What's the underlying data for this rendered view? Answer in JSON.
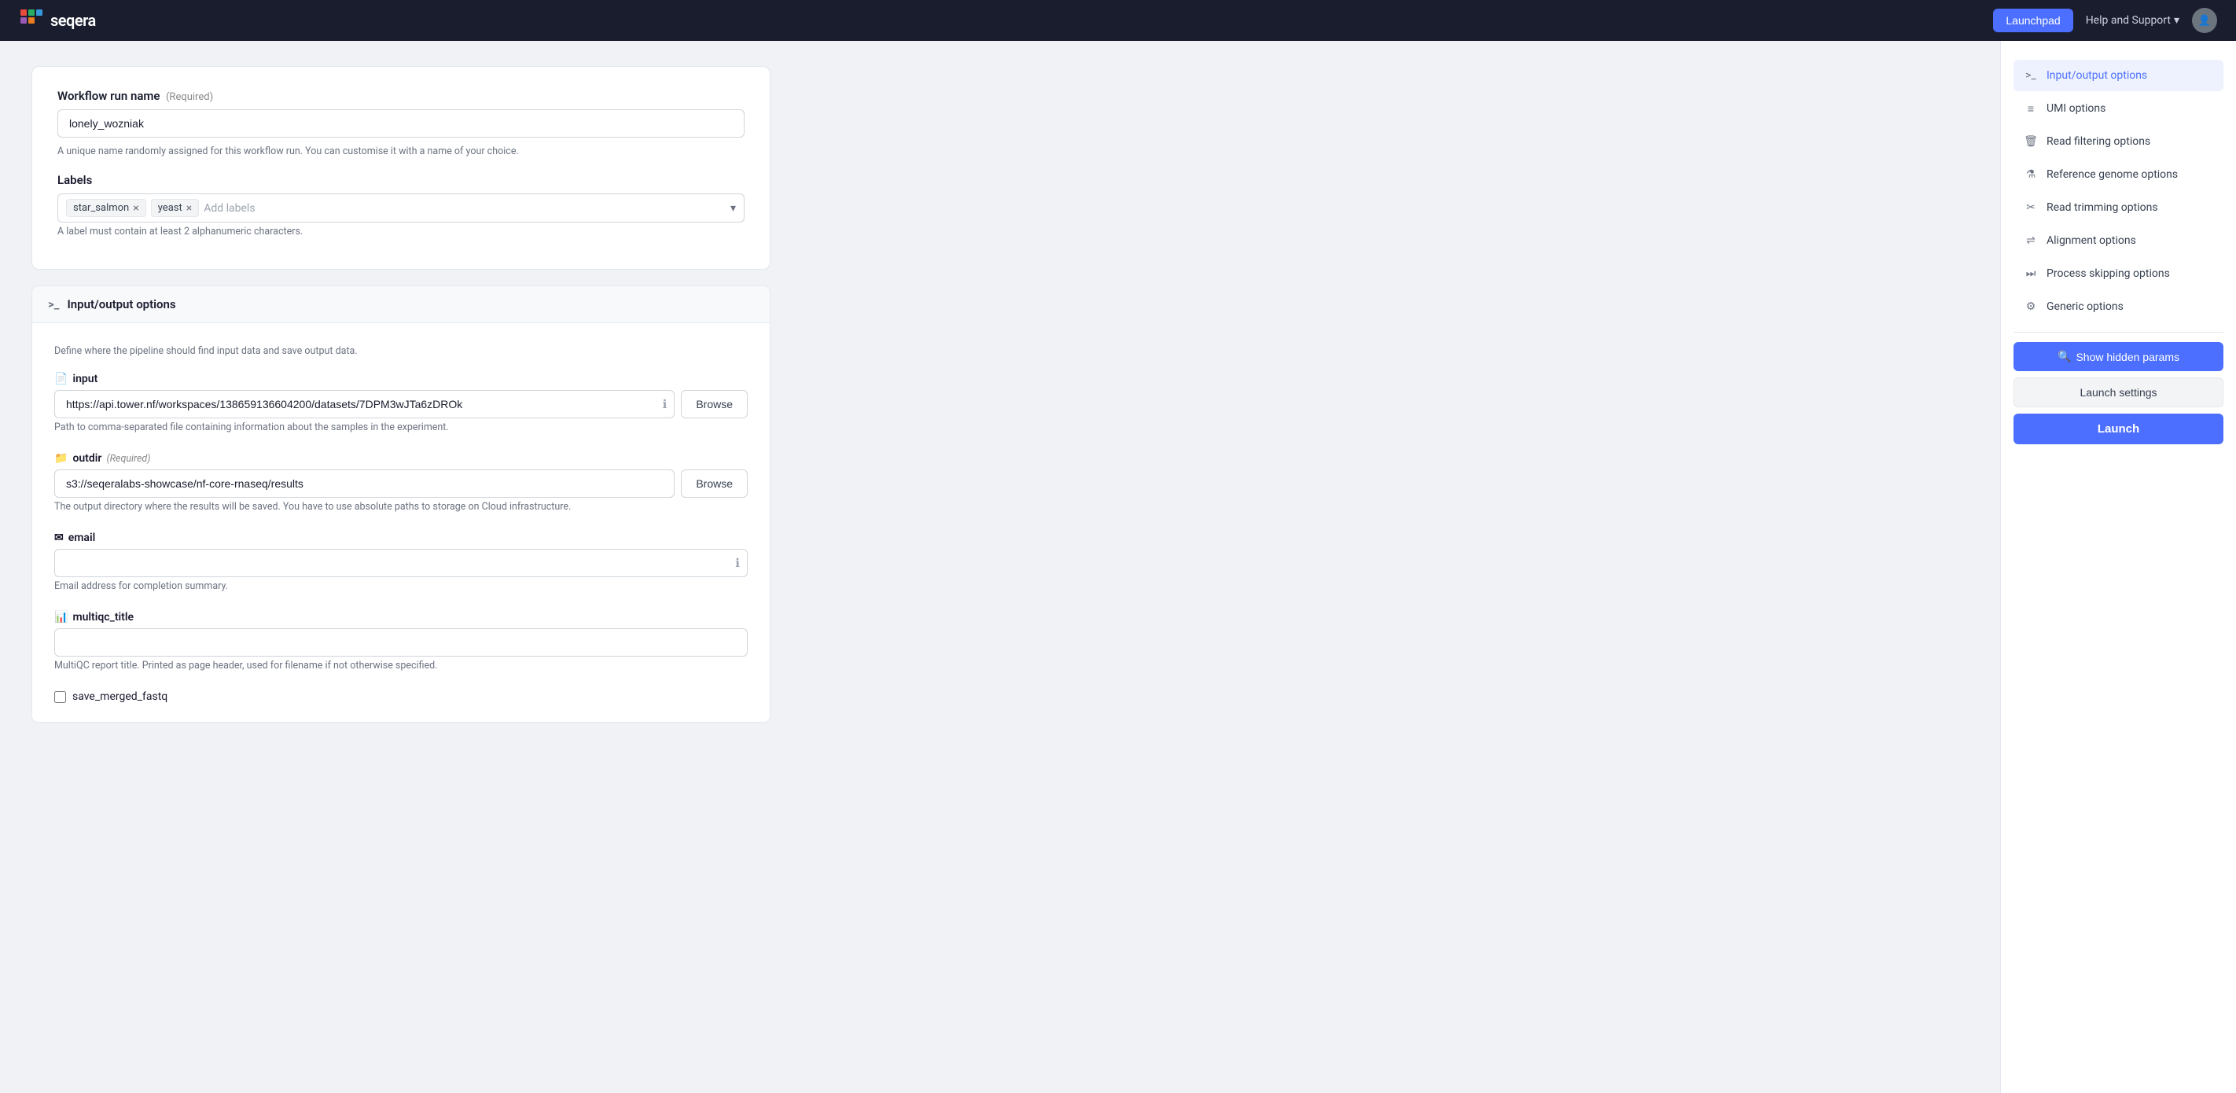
{
  "app": {
    "name": "seqera",
    "logo_text": "seqera"
  },
  "topnav": {
    "launchpad_label": "Launchpad",
    "help_support_label": "Help and Support",
    "help_support_arrow": "▾"
  },
  "workflow": {
    "run_name_label": "Workflow run name",
    "run_name_required": "(Required)",
    "run_name_value": "lonely_wozniak",
    "run_name_hint": "A unique name randomly assigned for this workflow run. You can customise it with a name of your choice.",
    "labels_label": "Labels",
    "labels_hint": "A label must contain at least 2 alphanumeric characters.",
    "labels": [
      {
        "text": "star_salmon"
      },
      {
        "text": "yeast"
      }
    ],
    "labels_placeholder": "Add labels"
  },
  "sections": {
    "input_output": {
      "title": "Input/output options",
      "icon": ">_",
      "description": "Define where the pipeline should find input data and save output data.",
      "input_label": "input",
      "input_value": "https://api.tower.nf/workspaces/138659136604200/datasets/7DPM3wJTa6zDROk",
      "input_hint": "Path to comma-separated file containing information about the samples in the experiment.",
      "outdir_label": "outdir",
      "outdir_required": "(Required)",
      "outdir_value": "s3://seqeralabs-showcase/nf-core-rnaseq/results",
      "outdir_hint": "The output directory where the results will be saved. You have to use absolute paths to storage on Cloud infrastructure.",
      "email_label": "email",
      "email_value": "",
      "email_placeholder": "",
      "email_hint": "Email address for completion summary.",
      "multiqc_title_label": "multiqc_title",
      "multiqc_title_value": "",
      "multiqc_title_hint": "MultiQC report title. Printed as page header, used for filename if not otherwise specified.",
      "save_merged_fastq_label": "save_merged_fastq",
      "browse_label": "Browse"
    }
  },
  "sidebar": {
    "nav_items": [
      {
        "id": "input-output",
        "label": "Input/output options",
        "icon": ">_",
        "active": true
      },
      {
        "id": "umi",
        "label": "UMI options",
        "icon": "≡",
        "active": false
      },
      {
        "id": "read-filtering",
        "label": "Read filtering options",
        "icon": "🗑",
        "active": false
      },
      {
        "id": "reference-genome",
        "label": "Reference genome options",
        "icon": "⚗",
        "active": false
      },
      {
        "id": "read-trimming",
        "label": "Read trimming options",
        "icon": "✂",
        "active": false
      },
      {
        "id": "alignment",
        "label": "Alignment options",
        "icon": "⇌",
        "active": false
      },
      {
        "id": "process-skipping",
        "label": "Process skipping options",
        "icon": "⏭",
        "active": false
      },
      {
        "id": "generic",
        "label": "Generic options",
        "icon": "⚙",
        "active": false
      }
    ],
    "show_hidden_label": "Show hidden params",
    "launch_settings_label": "Launch settings",
    "launch_label": "Launch"
  }
}
